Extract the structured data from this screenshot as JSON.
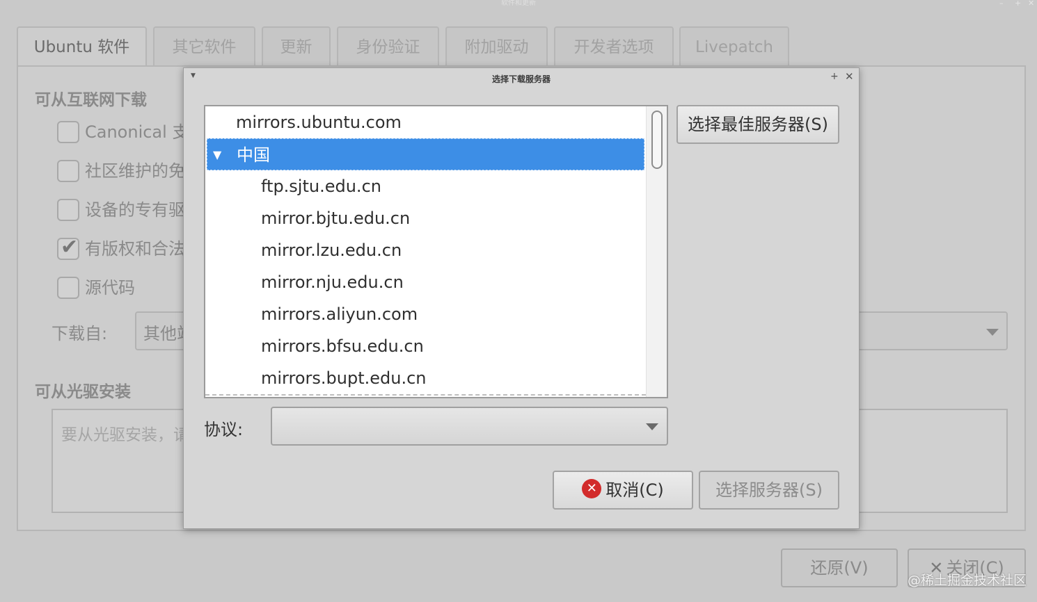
{
  "window": {
    "title": "软件和更新",
    "controls": [
      "–",
      "+",
      "✕"
    ]
  },
  "tabs": [
    {
      "label": "Ubuntu 软件",
      "active": true
    },
    {
      "label": "其它软件",
      "active": false
    },
    {
      "label": "更新",
      "active": false
    },
    {
      "label": "身份验证",
      "active": false
    },
    {
      "label": "附加驱动",
      "active": false
    },
    {
      "label": "开发者选项",
      "active": false
    },
    {
      "label": "Livepatch",
      "active": false
    }
  ],
  "main": {
    "internet_section_title": "可从互联网下载",
    "checkboxes": [
      {
        "label": "Canonical 支",
        "checked": false
      },
      {
        "label": "社区维护的免",
        "checked": false
      },
      {
        "label": "设备的专有驱",
        "checked": false
      },
      {
        "label": "有版权和合法",
        "checked": true
      },
      {
        "label": "源代码",
        "checked": false
      }
    ],
    "download_from_label": "下载自:",
    "download_from_value": "其他站",
    "cdrom_section_title": "可从光驱安装",
    "cdrom_hint": "要从光驱安装，请",
    "revert_button": "还原(V)",
    "close_button": "关闭(C)"
  },
  "dialog": {
    "title": "选择下载服务器",
    "top_server": "mirrors.ubuntu.com",
    "country": "中国",
    "servers": [
      "ftp.sjtu.edu.cn",
      "mirror.bjtu.edu.cn",
      "mirror.lzu.edu.cn",
      "mirror.nju.edu.cn",
      "mirrors.aliyun.com",
      "mirrors.bfsu.edu.cn",
      "mirrors.bupt.edu.cn"
    ],
    "best_server_button": "选择最佳服务器(S)",
    "protocol_label": "协议:",
    "protocol_value": "",
    "cancel_button": "取消(C)",
    "choose_server_button": "选择服务器(S)"
  },
  "watermark": "@稀土掘金技术社区",
  "colors": {
    "selection": "#3d8ee6",
    "cancel_icon": "#d22b2b"
  }
}
